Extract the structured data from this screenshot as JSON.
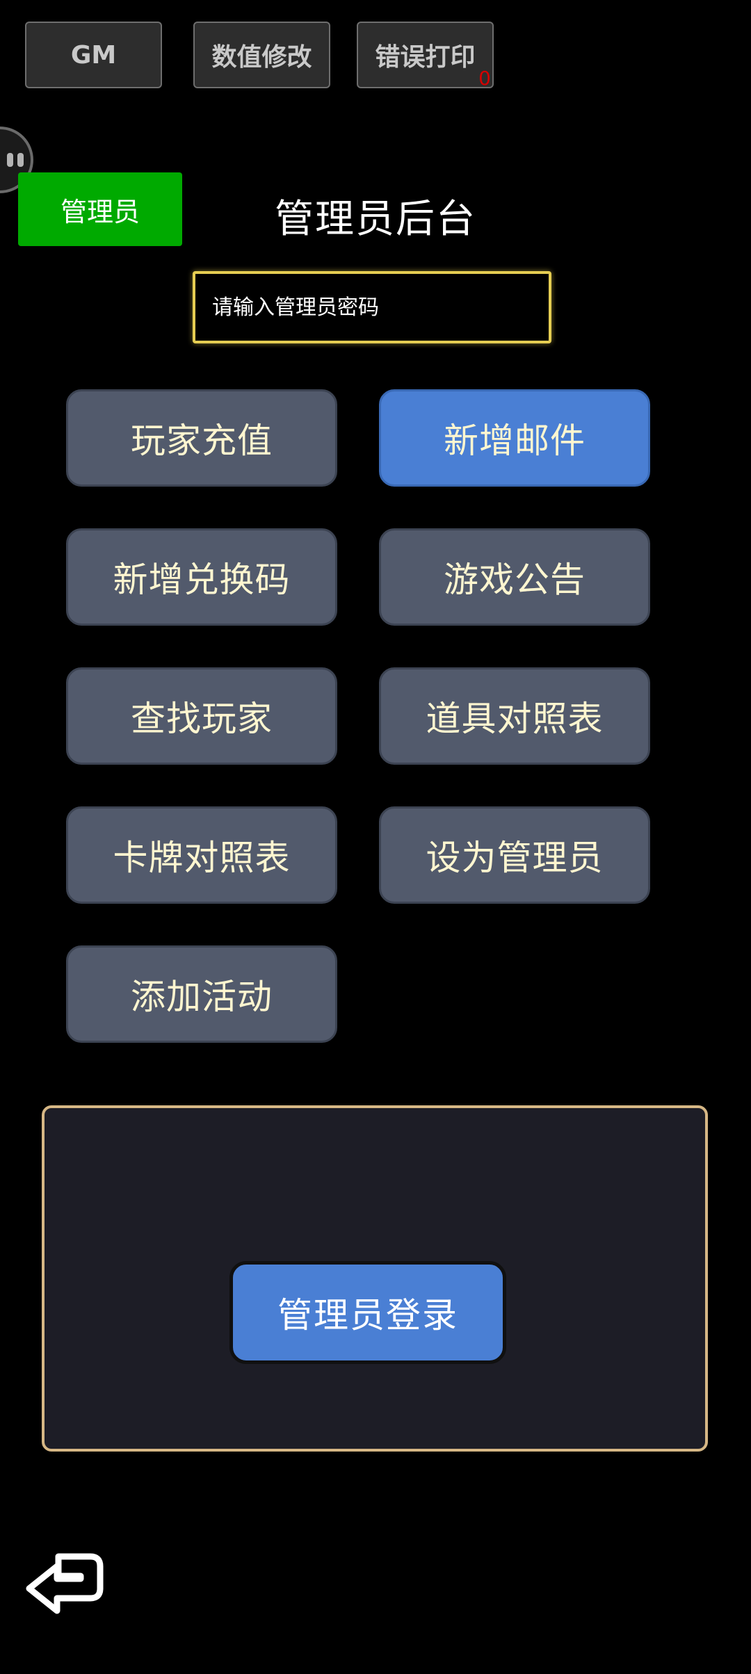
{
  "debug_toolbar": {
    "gm_label": "GM",
    "value_edit_label": "数值修改",
    "error_print_label": "错误打印",
    "error_count": "0"
  },
  "header": {
    "role_badge": "管理员",
    "title": "管理员后台"
  },
  "password_field": {
    "placeholder": "请输入管理员密码",
    "value": ""
  },
  "menu": {
    "items": [
      {
        "label": "玩家充值"
      },
      {
        "label": "新增邮件"
      },
      {
        "label": "新增兑换码"
      },
      {
        "label": "游戏公告"
      },
      {
        "label": "查找玩家"
      },
      {
        "label": "道具对照表"
      },
      {
        "label": "卡牌对照表"
      },
      {
        "label": "设为管理员"
      },
      {
        "label": "添加活动"
      }
    ]
  },
  "login": {
    "button_label": "管理员登录"
  },
  "colors": {
    "background": "#000000",
    "menu_button": "#525a6c",
    "menu_button_active": "#4a7fd4",
    "menu_text": "#fff6d0",
    "role_badge": "#00aa00",
    "input_border": "#e5cd52",
    "panel_border": "#d6b785",
    "panel_fill": "#1d1d26"
  },
  "icons": {
    "floating_handle": "floating-menu-handle-icon",
    "back": "return-arrow-icon"
  }
}
